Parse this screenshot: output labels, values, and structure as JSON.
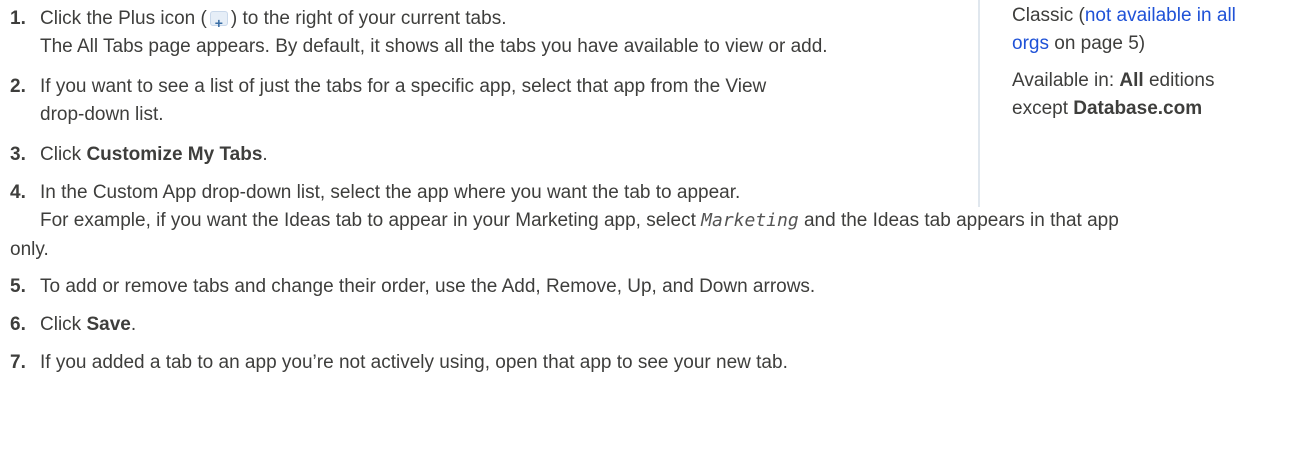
{
  "steps": [
    {
      "num": "1.",
      "pre": "Click the Plus icon (",
      "post": ") to the right of your current tabs.",
      "sub": "The All Tabs page appears. By default, it shows all the tabs you have available to view or add."
    },
    {
      "num": "2.",
      "line1": "If you want to see a list of just the tabs for a specific app, select that app from the View",
      "line2": "drop-down list."
    },
    {
      "num": "3.",
      "pre": "Click ",
      "bold": "Customize My Tabs",
      "post": "."
    },
    {
      "num": "4.",
      "line1": "In the Custom App drop-down list, select the app where you want the tab to appear.",
      "sub_pre": "For example, if you want the Ideas tab to appear in your Marketing app, select ",
      "sub_code": "Marketing",
      "sub_post": " and the Ideas tab appears in that app",
      "sub_end": "only."
    },
    {
      "num": "5.",
      "line1": "To add or remove tabs and change their order, use the Add, Remove, Up, and Down arrows."
    },
    {
      "num": "6.",
      "pre": "Click ",
      "bold": "Save",
      "post": "."
    },
    {
      "num": "7.",
      "line1": "If you added a tab to an app you’re not actively using, open that app to see your new tab."
    }
  ],
  "sidebar": {
    "classic_prefix": "Classic (",
    "link1": "not available in all",
    "link2": "orgs",
    "page_ref": " on page 5)",
    "avail_prefix": "Available in: ",
    "avail_bold": "All",
    "avail_mid": " editions",
    "except": "except ",
    "except_bold": "Database.com"
  },
  "icons": {
    "plus": "plus-icon"
  }
}
